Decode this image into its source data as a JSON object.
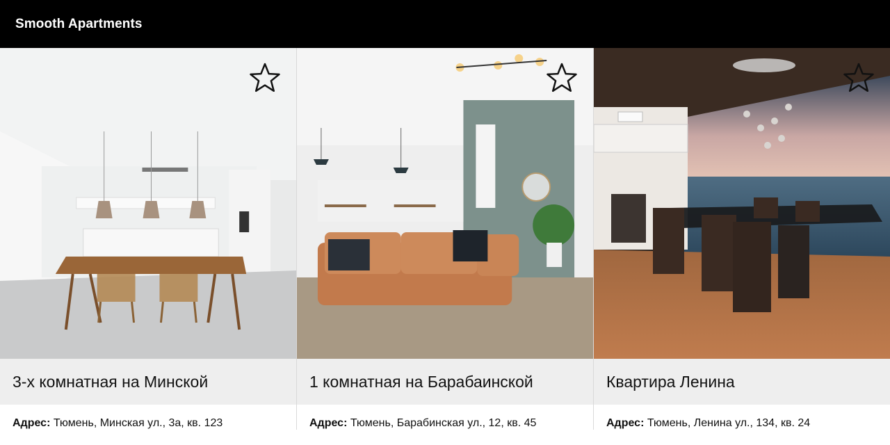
{
  "header": {
    "brand": "Smooth Apartments"
  },
  "listings": [
    {
      "title": "3-х комнатная на Минской",
      "address_label": "Адрес:",
      "address": "Тюмень, Минская ул., 3а, кв. 123",
      "favorite": false
    },
    {
      "title": "1 комнатная на Барабаинской",
      "address_label": "Адрес:",
      "address": "Тюмень, Барабинская ул., 12, кв. 45",
      "favorite": false
    },
    {
      "title": "Квартира Ленина",
      "address_label": "Адрес:",
      "address": "Тюмень, Ленина ул., 134, кв. 24",
      "favorite": false
    }
  ]
}
